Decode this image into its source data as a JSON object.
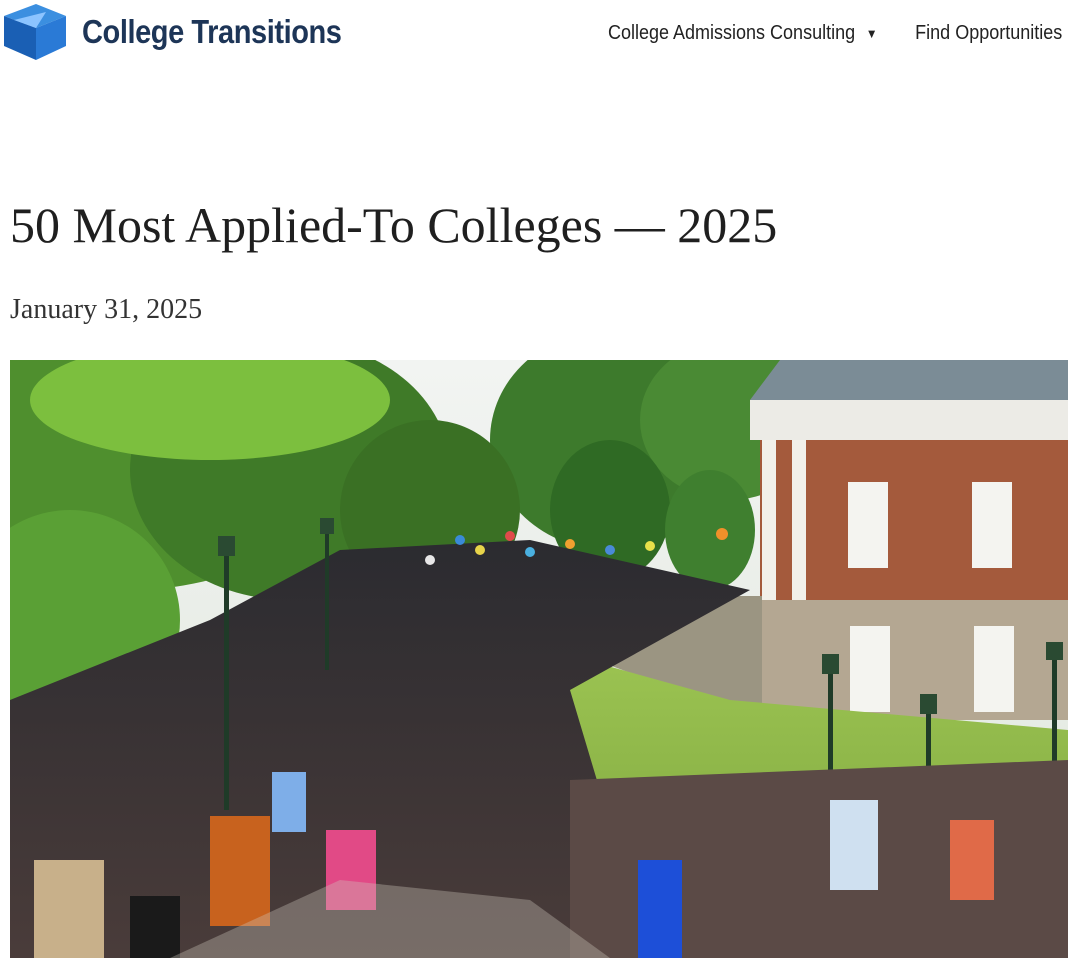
{
  "header": {
    "logo_text": "College Transitions",
    "logo_icon": "paper-plane-box-icon",
    "brand_color": "#1a73e8",
    "nav": [
      {
        "label": "College Admissions Consulting",
        "has_dropdown": true
      },
      {
        "label": "Find Opportunities",
        "has_dropdown": false
      }
    ]
  },
  "article": {
    "title": "50 Most Applied-To Colleges — 2025",
    "date": "January 31, 2025"
  },
  "hero_image": {
    "subject": "graduation-procession-photo"
  }
}
